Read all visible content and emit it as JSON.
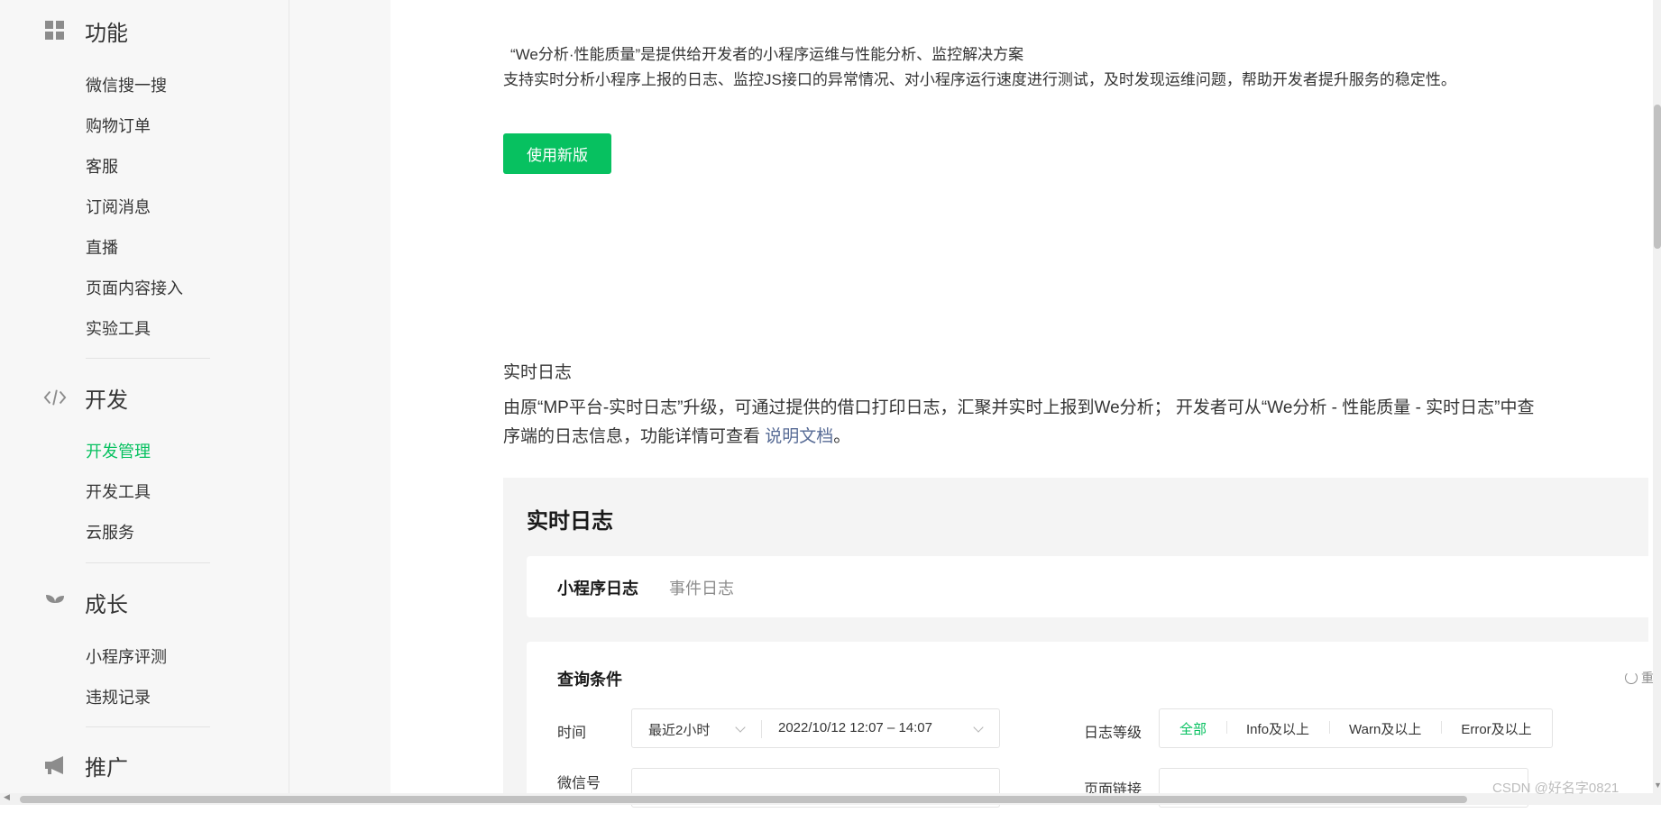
{
  "sidebar": {
    "sections": [
      {
        "title": "功能",
        "icon": "grid-icon",
        "items": [
          "微信搜一搜",
          "购物订单",
          "客服",
          "订阅消息",
          "直播",
          "页面内容接入",
          "实验工具"
        ]
      },
      {
        "title": "开发",
        "icon": "code-icon",
        "items": [
          "开发管理",
          "开发工具",
          "云服务"
        ],
        "active": "开发管理"
      },
      {
        "title": "成长",
        "icon": "sprout-icon",
        "items": [
          "小程序评测",
          "违规记录"
        ]
      },
      {
        "title": "推广",
        "icon": "megaphone-icon",
        "items": []
      }
    ]
  },
  "main": {
    "intro_line1": "“We分析·性能质量”是提供给开发者的小程序运维与性能分析、监控解决方案",
    "intro_line2": "支持实时分析小程序上报的日志、监控JS接口的异常情况、对小程序运行速度进行测试，及时发现运维问题，帮助开发者提升服务的稳定性。",
    "new_version_button": "使用新版",
    "realtime_title": "实时日志",
    "realtime_desc_part1": "由原“MP平台-实时日志”升级，可通过提供的借口打印日志，汇聚并实时上报到We分析；  开发者可从“We分析 - 性能质量 - 实时日志”中查",
    "realtime_desc_part2": "序端的日志信息，功能详情可查看 ",
    "realtime_desc_link": "说明文档",
    "realtime_desc_end": "。",
    "panel": {
      "title": "实时日志",
      "tabs": [
        "小程序日志",
        "事件日志"
      ],
      "query_title": "查询条件",
      "reset_label": "重",
      "time_label": "时间",
      "time_range": "最近2小时",
      "time_value": "2022/10/12 12:07 – 14:07",
      "level_label": "日志等级",
      "levels": [
        "全部",
        "Info及以上",
        "Warn及以上",
        "Error及以上"
      ],
      "wechat_label": "微信号",
      "page_link_label": "页面链接"
    }
  },
  "watermark": "CSDN @好名字0821",
  "colors": {
    "accent": "#07c160",
    "link": "#576b95",
    "sidebar_bg": "#f7f7f7"
  }
}
